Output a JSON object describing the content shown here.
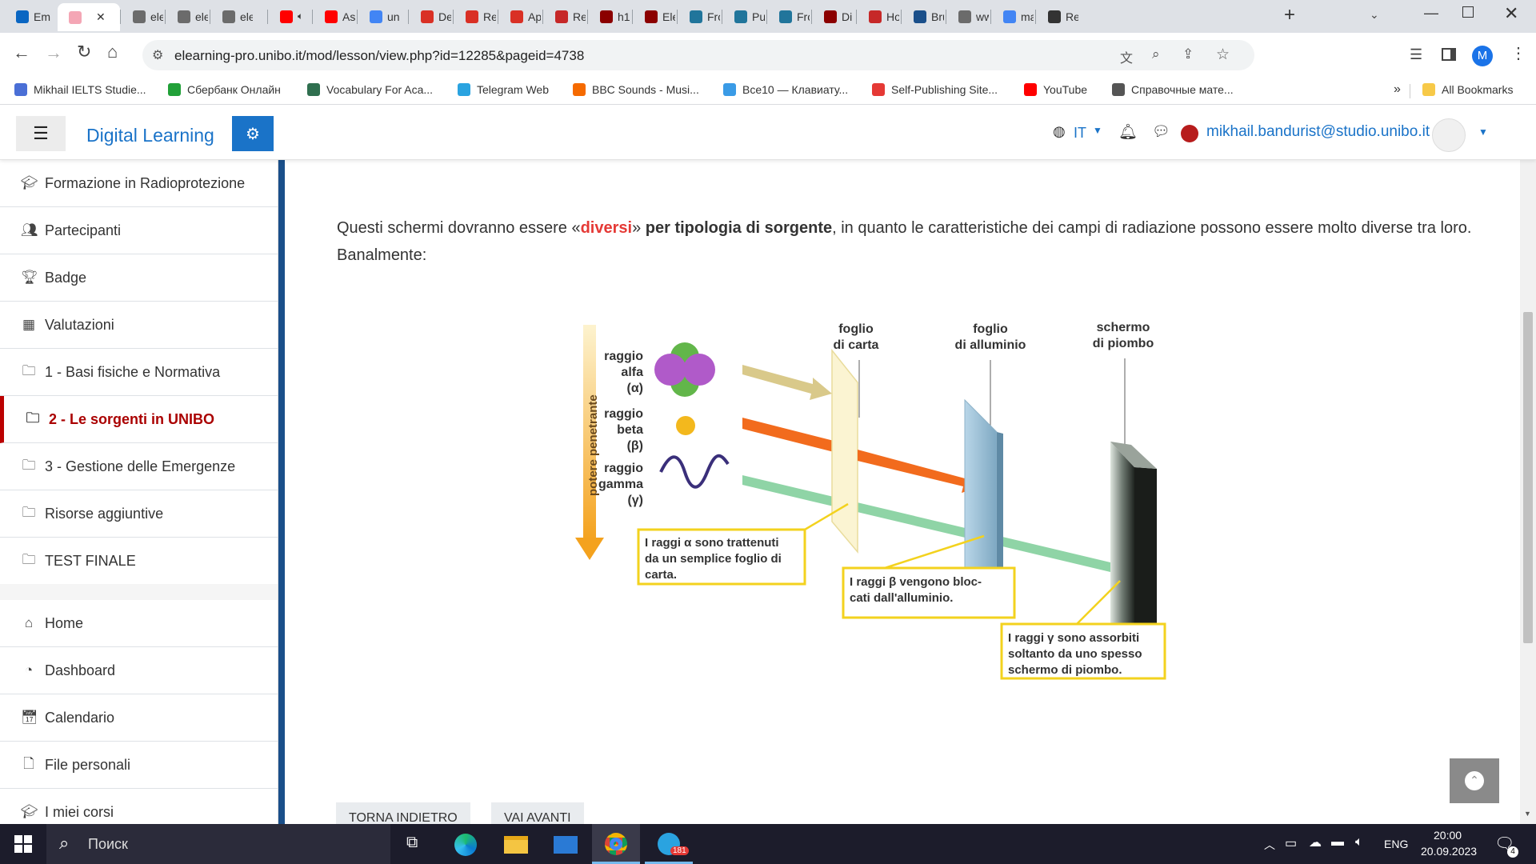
{
  "browser": {
    "tabs": [
      {
        "label": "Em",
        "color": "#0a66c2"
      },
      {
        "label": "",
        "color": "#f4a6b5"
      },
      {
        "label": "ele",
        "color": "#6b6b6b"
      },
      {
        "label": "ele",
        "color": "#6b6b6b"
      },
      {
        "label": "ele",
        "color": "#6b6b6b"
      },
      {
        "label": "",
        "color": "#ff0000"
      },
      {
        "label": "As",
        "color": "#ff0000"
      },
      {
        "label": "un",
        "color": "#4285f4"
      },
      {
        "label": "De",
        "color": "#d93025"
      },
      {
        "label": "Re",
        "color": "#d93025"
      },
      {
        "label": "Ap",
        "color": "#d93025"
      },
      {
        "label": "Re",
        "color": "#c62828"
      },
      {
        "label": "h1",
        "color": "#8b0000"
      },
      {
        "label": "Ele",
        "color": "#8b0000"
      },
      {
        "label": "Fro",
        "color": "#21759b"
      },
      {
        "label": "Pu",
        "color": "#21759b"
      },
      {
        "label": "Fro",
        "color": "#21759b"
      },
      {
        "label": "Di",
        "color": "#8b0000"
      },
      {
        "label": "Ho",
        "color": "#c62828"
      },
      {
        "label": "Bru",
        "color": "#1a4f8a"
      },
      {
        "label": "ww",
        "color": "#6b6b6b"
      },
      {
        "label": "ma",
        "color": "#4285f4"
      },
      {
        "label": "Re",
        "color": "#333333"
      }
    ],
    "url": "elearning-pro.unibo.it/mod/lesson/view.php?id=12285&pageid=4738",
    "profile_initial": "M",
    "bookmarks": [
      {
        "label": "Mikhail IELTS Studie...",
        "color": "#4a6fd6"
      },
      {
        "label": "Сбербанк Онлайн",
        "color": "#21a038"
      },
      {
        "label": "Vocabulary For Aca...",
        "color": "#2f6f4f"
      },
      {
        "label": "Telegram Web",
        "color": "#2aa3e0"
      },
      {
        "label": "BBC Sounds - Musi...",
        "color": "#f56a00"
      },
      {
        "label": "Все10 — Клавиату...",
        "color": "#3a9be6"
      },
      {
        "label": "Self-Publishing Site...",
        "color": "#e53935"
      },
      {
        "label": "YouTube",
        "color": "#ff0000"
      },
      {
        "label": "Справочные мате...",
        "color": "#555555"
      }
    ],
    "bookmarks_more": "»",
    "all_bookmarks": "All Bookmarks"
  },
  "header": {
    "site_name": "Digital Learning",
    "language": "IT",
    "user_email": "mikhail.bandurist@studio.unibo.it"
  },
  "sidebar": {
    "items": [
      {
        "label": "Formazione in Radioprotezione",
        "icon": "graduation-cap"
      },
      {
        "label": "Partecipanti",
        "icon": "users"
      },
      {
        "label": "Badge",
        "icon": "trophy"
      },
      {
        "label": "Valutazioni",
        "icon": "table"
      },
      {
        "label": "1 - Basi fisiche e Normativa",
        "icon": "folder"
      },
      {
        "label": "2 - Le sorgenti in UNIBO",
        "icon": "folder"
      },
      {
        "label": "3 - Gestione delle Emergenze",
        "icon": "folder"
      },
      {
        "label": "Risorse aggiuntive",
        "icon": "folder"
      },
      {
        "label": "TEST FINALE",
        "icon": "folder"
      }
    ],
    "nav": [
      {
        "label": "Home",
        "icon": "home"
      },
      {
        "label": "Dashboard",
        "icon": "dashboard"
      },
      {
        "label": "Calendario",
        "icon": "calendar"
      },
      {
        "label": "File personali",
        "icon": "file"
      },
      {
        "label": "I miei corsi",
        "icon": "graduation-cap"
      }
    ]
  },
  "content": {
    "para_a": "Questi schermi dovranno essere «",
    "para_b": "diversi",
    "para_c": "» ",
    "para_d": "per tipologia di sorgente",
    "para_e": ", in quanto le caratteristiche dei campi di radiazione possono essere molto diverse tra loro. Banalmente:",
    "accent": "#e53935"
  },
  "figure": {
    "axis_label": "potere penetrante",
    "rays": [
      {
        "name": "raggio alfa",
        "symbol": "(α)",
        "color": "#d9c98a"
      },
      {
        "name": "raggio beta",
        "symbol": "(β)",
        "color": "#f26b1d"
      },
      {
        "name": "raggio gamma",
        "symbol": "(γ)",
        "color": "#8fd4a6"
      }
    ],
    "screens": [
      {
        "label1": "foglio",
        "label2": "di carta"
      },
      {
        "label1": "foglio",
        "label2": "di alluminio"
      },
      {
        "label1": "schermo",
        "label2": "di piombo"
      }
    ],
    "captions": [
      {
        "l1": "I raggi α sono trattenuti",
        "l2": "da un semplice foglio di",
        "l3": "carta."
      },
      {
        "l1": "I raggi β vengono bloc-",
        "l2": "cati dall'alluminio.",
        "l3": ""
      },
      {
        "l1": "I raggi γ sono assorbiti",
        "l2": "soltanto da uno spesso",
        "l3": "schermo di piombo."
      }
    ]
  },
  "buttons": {
    "back": "Torna indietro",
    "next": "Vai avanti"
  },
  "taskbar": {
    "search": "Поиск",
    "lang": "ENG",
    "time": "20:00",
    "date": "20.09.2023",
    "telegram_badge": "181",
    "notif_count": "4"
  }
}
